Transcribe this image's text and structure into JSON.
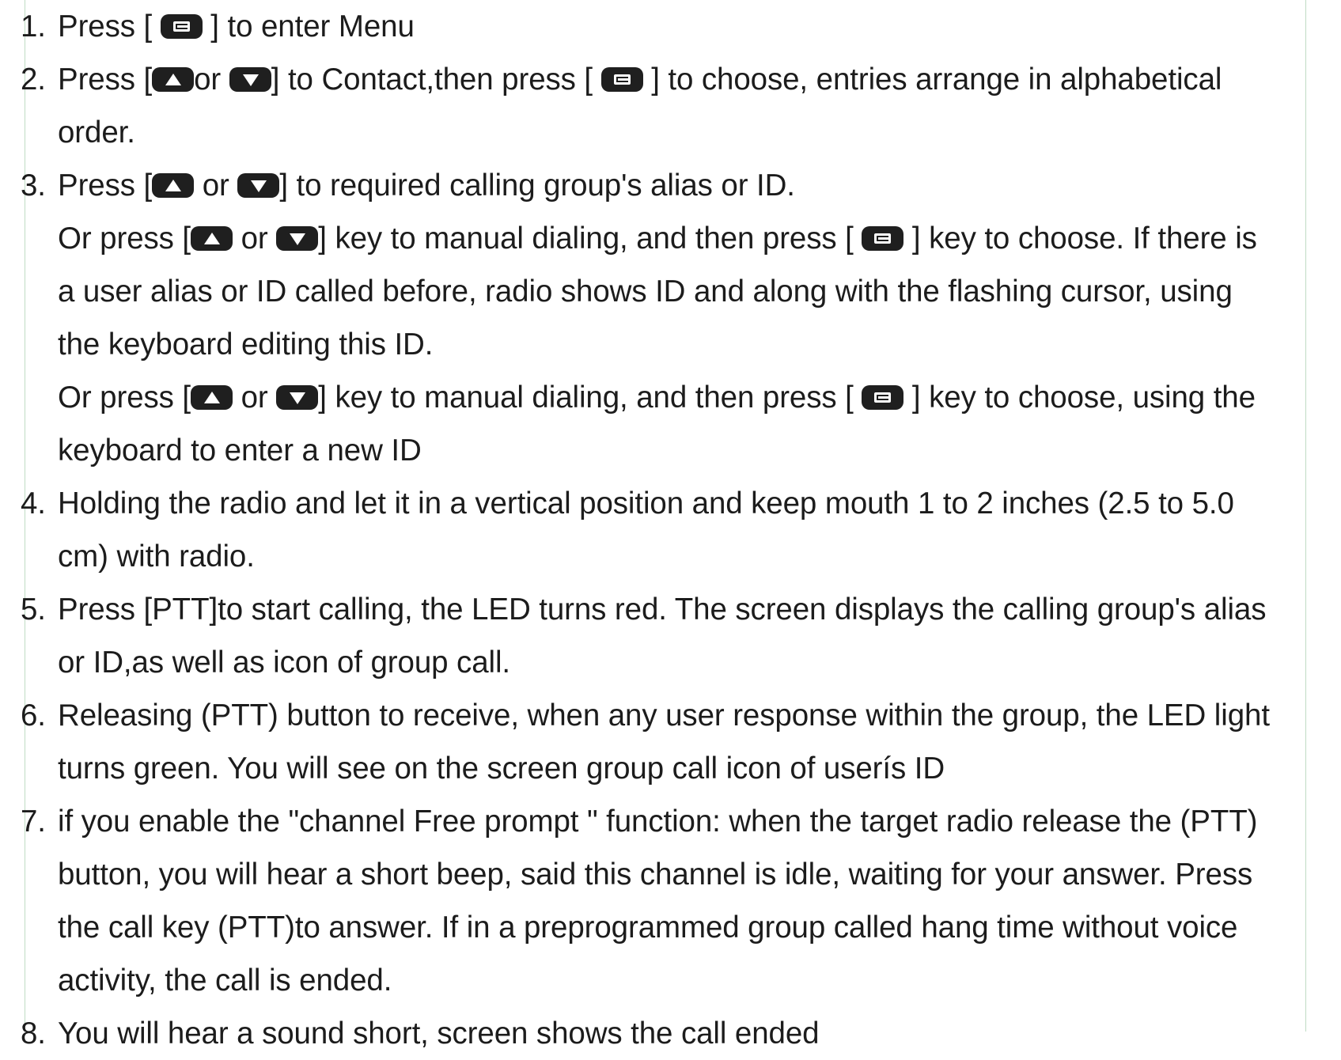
{
  "steps": [
    {
      "number": "1.",
      "lines": [
        [
          "Press [ ",
          {
            "key": "menu-key"
          },
          " ] to enter Menu"
        ]
      ]
    },
    {
      "number": "2.",
      "lines": [
        [
          "Press [",
          {
            "key": "up-key"
          },
          "or ",
          {
            "key": "down-key"
          },
          "] to Contact,then press [ ",
          {
            "key": "menu-key"
          },
          " ] to choose, entries arrange in alphabetical"
        ],
        [
          "order."
        ]
      ]
    },
    {
      "number": "3.",
      "lines": [
        [
          "Press [",
          {
            "key": "up-key"
          },
          " or ",
          {
            "key": "down-key"
          },
          "] to required calling group's alias or ID."
        ],
        [
          "Or press [",
          {
            "key": "up-key"
          },
          " or ",
          {
            "key": "down-key"
          },
          "] key to manual dialing, and then press [ ",
          {
            "key": "menu-key"
          },
          " ] key to choose. If there is"
        ],
        [
          "a user alias or ID called before, radio shows ID and along with the flashing cursor, using"
        ],
        [
          "the keyboard editing this ID."
        ],
        [
          "Or press [",
          {
            "key": "up-key"
          },
          " or ",
          {
            "key": "down-key"
          },
          "] key to manual dialing, and then press [ ",
          {
            "key": "menu-key"
          },
          " ] key to choose, using the"
        ],
        [
          "keyboard to enter a new ID"
        ]
      ]
    },
    {
      "number": "4.",
      "lines": [
        [
          "Holding the radio and let it in a vertical position and keep mouth 1 to 2 inches (2.5 to 5.0"
        ],
        [
          "cm) with radio."
        ]
      ]
    },
    {
      "number": "5.",
      "lines": [
        [
          "Press [PTT]to start calling, the LED turns red. The screen displays the calling group's alias"
        ],
        [
          "or ID,as well as icon of group call."
        ]
      ]
    },
    {
      "number": "6.",
      "lines": [
        [
          "Releasing (PTT) button  to receive, when any user response within the group, the LED light"
        ],
        [
          "turns green. You will see on the screen group call icon of userís ID"
        ]
      ]
    },
    {
      "number": "7.",
      "lines": [
        [
          "if you enable the \"channel Free prompt \" function: when the target radio release the (PTT)"
        ],
        [
          "button, you will hear a short beep, said this channel is idle, waiting for your answer. Press"
        ],
        [
          "the call key (PTT)to  answer. If in a preprogrammed group called hang time without voice"
        ],
        [
          "activity, the call is ended."
        ]
      ]
    },
    {
      "number": "8.",
      "lines": [
        [
          "You will hear a sound short, screen shows the call ended"
        ]
      ]
    }
  ]
}
